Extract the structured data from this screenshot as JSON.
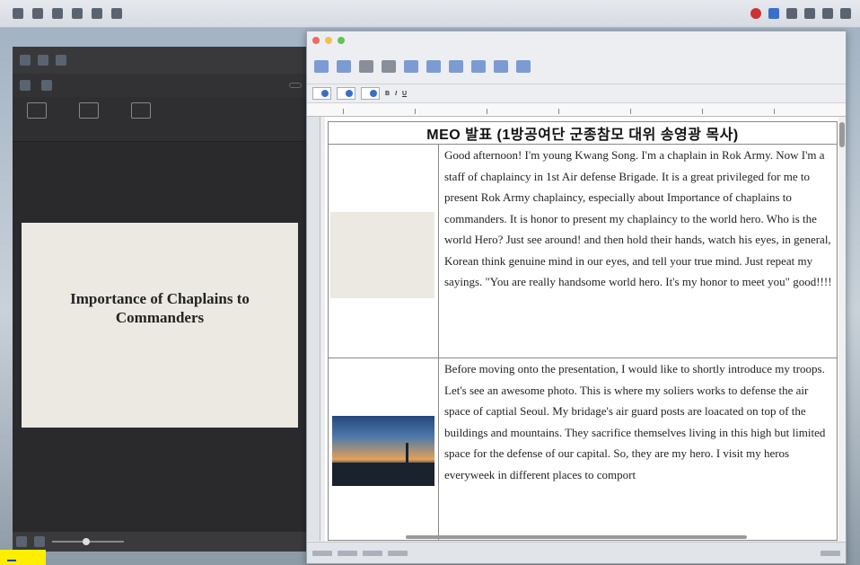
{
  "ppt": {
    "slide_title": "Importance of Chaplains to Commanders"
  },
  "hwp": {
    "doc_title": "MEO 발표 (1방공여단 군종참모 대위 송영광 목사)",
    "paragraph1": "Good afternoon! I'm young Kwang Song. I'm a chaplain in Rok Army. Now I'm a staff of chaplaincy in 1st Air defense Brigade. It is a great privileged for me to present Rok Army chaplaincy, especially about Importance of chaplains to commanders. It is honor to present my chaplaincy to the world hero. Who is the world Hero? Just see around! and then hold their hands, watch his eyes, in general, Korean think genuine mind in our eyes, and tell your true mind. Just repeat my sayings. \"You are really handsome world hero. It's my honor to meet you\" good!!!!",
    "paragraph2": "Before moving onto the presentation, I would like to shortly introduce my troops. Let's see an awesome photo. This is where my soliers works to defense the air space of captial Seoul. My bridage's air guard posts are loacated on top of the buildings and mountains. They sacrifice themselves living in this high but limited space for the defense of our capital. So, they are my hero. I visit my heros everyweek in different places to comport"
  }
}
